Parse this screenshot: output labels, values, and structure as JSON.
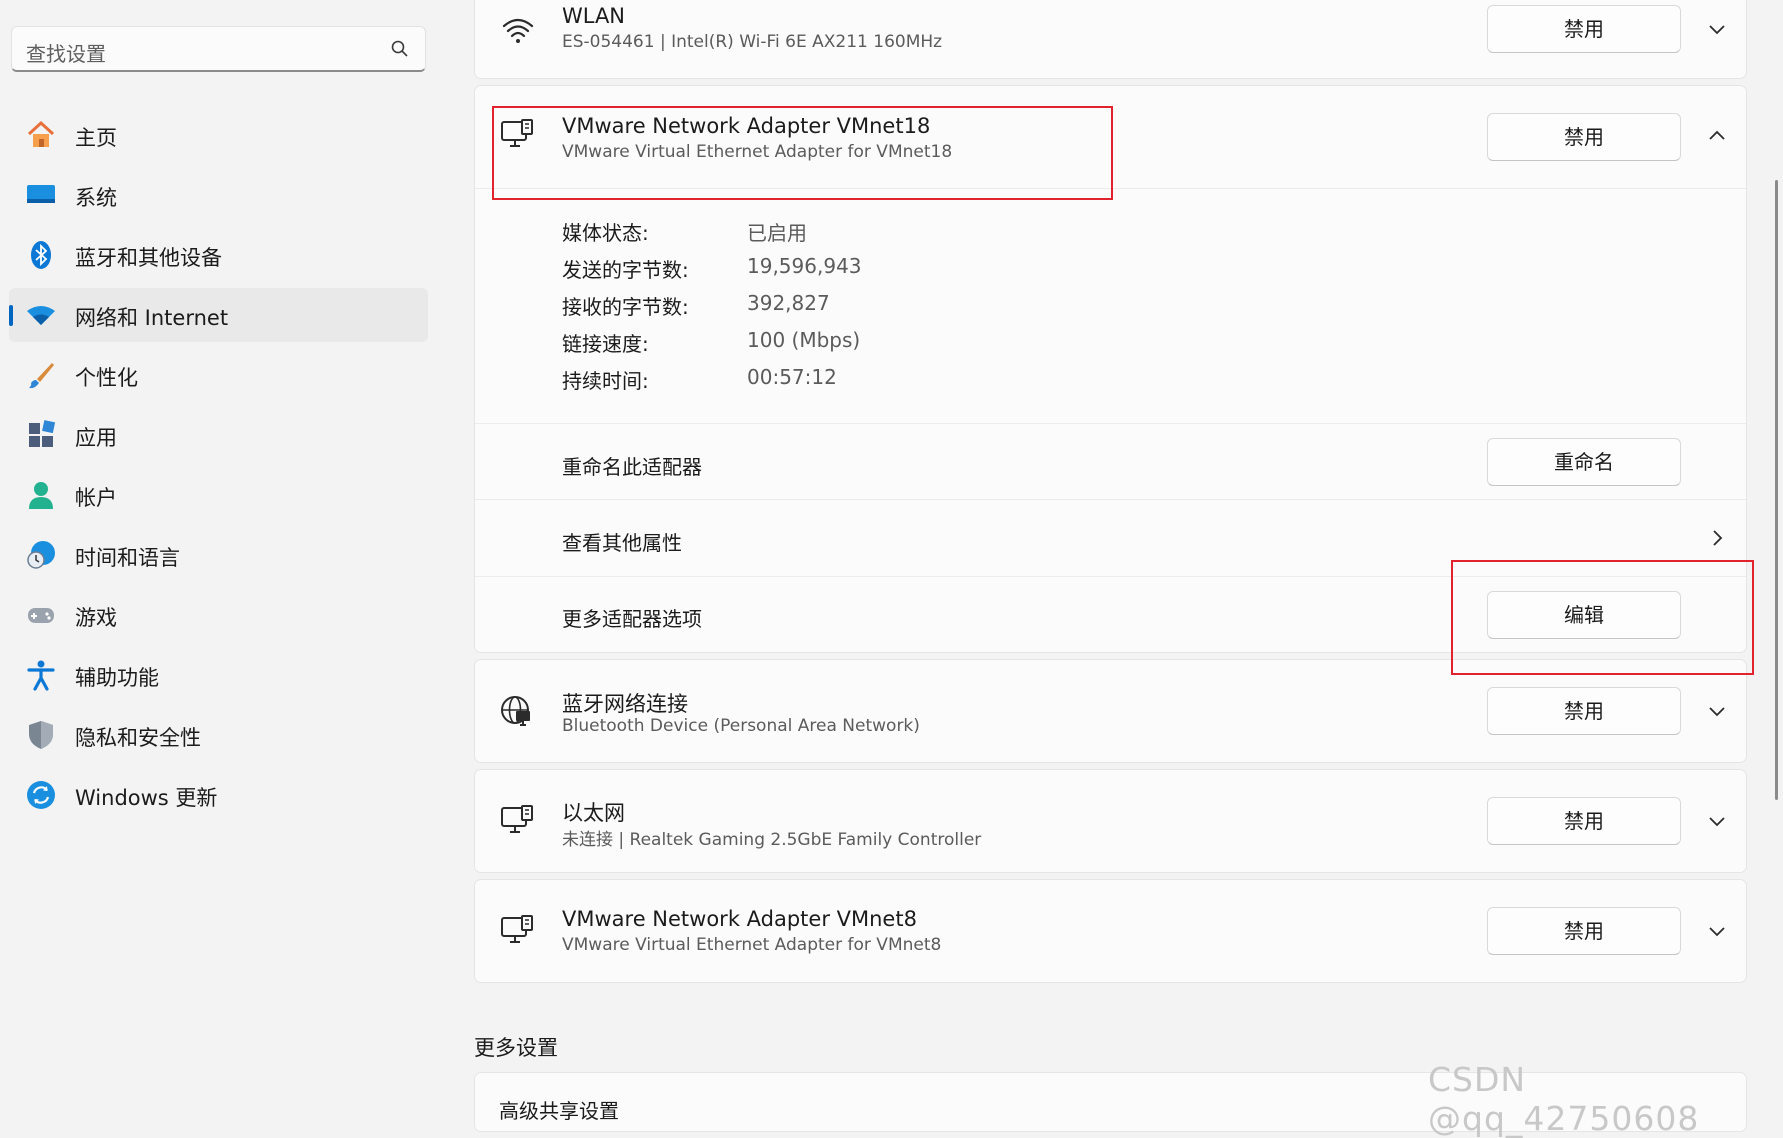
{
  "search": {
    "placeholder": "查找设置"
  },
  "sidebar": {
    "items": [
      {
        "label": "主页",
        "icon": "home-icon"
      },
      {
        "label": "系统",
        "icon": "system-icon"
      },
      {
        "label": "蓝牙和其他设备",
        "icon": "bluetooth-icon"
      },
      {
        "label": "网络和 Internet",
        "icon": "wifi-icon",
        "active": true
      },
      {
        "label": "个性化",
        "icon": "brush-icon"
      },
      {
        "label": "应用",
        "icon": "apps-icon"
      },
      {
        "label": "帐户",
        "icon": "account-icon"
      },
      {
        "label": "时间和语言",
        "icon": "globe-clock-icon"
      },
      {
        "label": "游戏",
        "icon": "gamepad-icon"
      },
      {
        "label": "辅助功能",
        "icon": "accessibility-icon"
      },
      {
        "label": "隐私和安全性",
        "icon": "shield-icon"
      },
      {
        "label": "Windows 更新",
        "icon": "update-icon"
      }
    ]
  },
  "adapters": {
    "wlan": {
      "title": "WLAN",
      "subtitle": "ES-054461 | Intel(R) Wi-Fi 6E AX211 160MHz",
      "button": "禁用"
    },
    "vmnet18": {
      "title": "VMware Network Adapter VMnet18",
      "subtitle": "VMware Virtual Ethernet Adapter for VMnet18",
      "button": "禁用",
      "props": [
        {
          "k": "媒体状态:",
          "v": "已启用"
        },
        {
          "k": "发送的字节数:",
          "v": "19,596,943"
        },
        {
          "k": "接收的字节数:",
          "v": "392,827"
        },
        {
          "k": "链接速度:",
          "v": "100 (Mbps)"
        },
        {
          "k": "持续时间:",
          "v": "00:57:12"
        }
      ],
      "rename_label": "重命名此适配器",
      "rename_button": "重命名",
      "view_props_label": "查看其他属性",
      "more_options_label": "更多适配器选项",
      "edit_button": "编辑"
    },
    "bluetooth": {
      "title": "蓝牙网络连接",
      "subtitle": "Bluetooth Device (Personal Area Network)",
      "button": "禁用"
    },
    "ethernet": {
      "title": "以太网",
      "subtitle": "未连接 | Realtek Gaming 2.5GbE Family Controller",
      "button": "禁用"
    },
    "vmnet8": {
      "title": "VMware Network Adapter VMnet8",
      "subtitle": "VMware Virtual Ethernet Adapter for VMnet8",
      "button": "禁用"
    }
  },
  "more_settings": {
    "title": "更多设置",
    "item": "高级共享设置"
  },
  "watermark": "CSDN @qq_42750608",
  "colors": {
    "accent": "#0067c0",
    "highlight_box": "#e0232d"
  }
}
